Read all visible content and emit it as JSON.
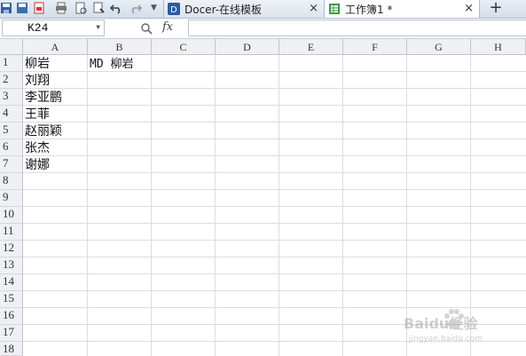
{
  "tabs": [
    {
      "label": "Docer-在线模板",
      "close": "×"
    },
    {
      "label": "工作簿1 *",
      "close": "×"
    }
  ],
  "new_tab": "+",
  "formula_bar": {
    "name_box": "K24",
    "fx": "fx",
    "formula_value": ""
  },
  "columns": [
    "A",
    "B",
    "C",
    "D",
    "E",
    "F",
    "G",
    "H"
  ],
  "rows": [
    "1",
    "2",
    "3",
    "4",
    "5",
    "6",
    "7",
    "8",
    "9",
    "10",
    "11",
    "12",
    "13",
    "14",
    "15",
    "16",
    "17",
    "18"
  ],
  "cells": {
    "A1": "柳岩",
    "B1": "MD 柳岩",
    "A2": "刘翔",
    "A3": "李亚鹏",
    "A4": "王菲",
    "A5": "赵丽颖",
    "A6": "张杰",
    "A7": "谢娜"
  },
  "watermark": {
    "brand": "Baidu经验",
    "url": "jingyan.baidu.com"
  }
}
